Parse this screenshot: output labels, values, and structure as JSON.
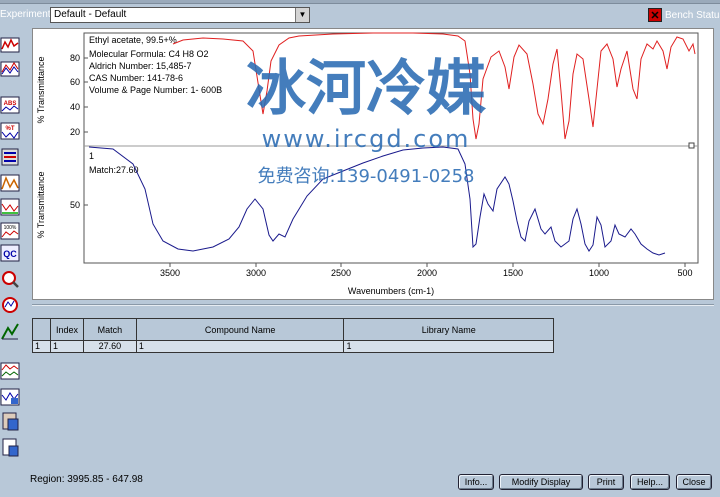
{
  "header": {
    "experiment_label": "Experiment:",
    "experiment_value": "Default - Default",
    "bench_status_label": "Bench Status"
  },
  "toolbar_icons": [
    "spectrum-tool-icon",
    "overlay-spectra-icon",
    "absorbance-icon",
    "transmittance-icon",
    "library-search-icon",
    "peak-pick-icon",
    "baseline-icon",
    "percent-scale-icon",
    "qc-check-icon",
    "zoom-search-icon",
    "find-peaks-icon",
    "scale-tool-icon",
    "multi-spectra-icon",
    "compare-spectra-icon",
    "clipboard-copy-icon",
    "report-icon"
  ],
  "spectrum": {
    "watermark": {
      "title": "冰河冷媒",
      "url": "www.ircgd.com",
      "phone": "免费咨询:139-0491-0258"
    },
    "top": {
      "ylabel": "% Transmittance",
      "yticks": [
        "80",
        "60",
        "40",
        "20"
      ],
      "info": [
        "Ethyl acetate, 99.5+%",
        "Molecular Formula:  C4 H8 O2",
        "Aldrich Number:  15,485-7",
        "CAS Number:  141-78-6",
        "Volume & Page Number:  1- 600B"
      ],
      "color": "#e02020"
    },
    "bottom": {
      "ylabel": "% Transmittance",
      "yticks": [
        "50"
      ],
      "index_label": "1",
      "match_label": "Match:27.60",
      "color": "#1a1a8c"
    },
    "xaxis": {
      "label": "Wavenumbers (cm-1)",
      "ticks": [
        "3500",
        "3000",
        "2500",
        "2000",
        "1500",
        "1000",
        "500"
      ]
    }
  },
  "results": {
    "headers": [
      "",
      "Index",
      "Match",
      "Compound Name",
      "Library Name"
    ],
    "rows": [
      [
        "1",
        "1",
        "27.60",
        "1",
        "1"
      ]
    ]
  },
  "footer": {
    "region_label": "Region:",
    "region_value": "3995.85 -  647.98",
    "buttons": {
      "info": "Info...",
      "modify": "Modify Display",
      "print": "Print",
      "help": "Help...",
      "close": "Close"
    }
  }
}
